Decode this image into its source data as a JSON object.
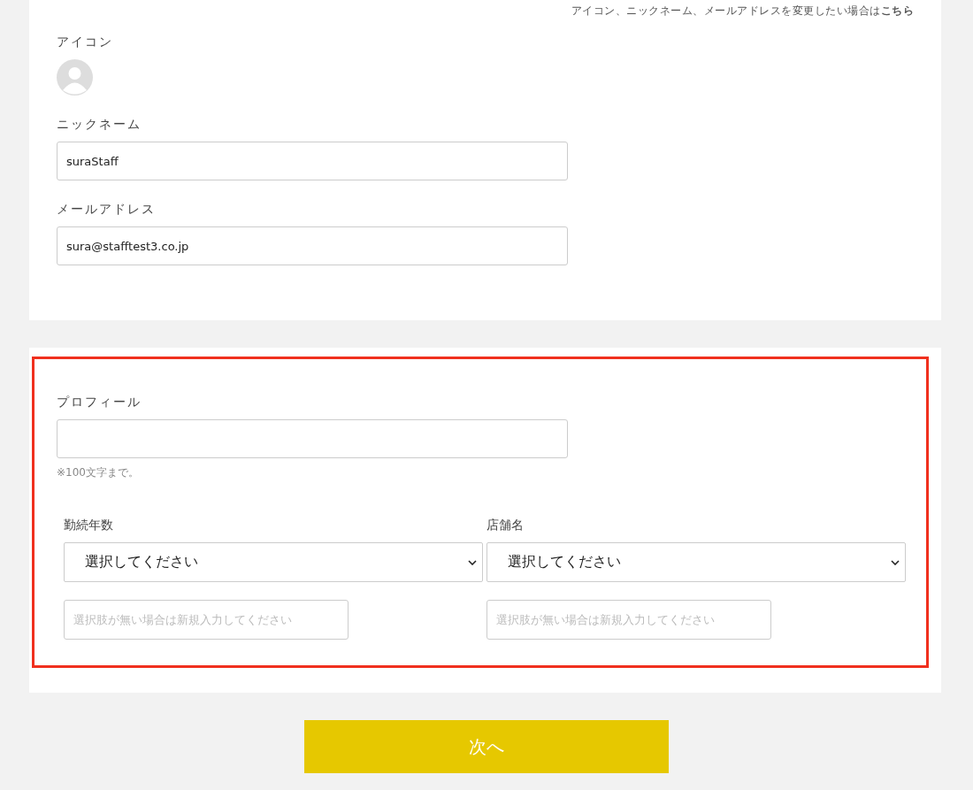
{
  "account_note": "アイコン、ニックネーム、メールアドレスを変更したい場合は**こちら**",
  "icon_label": "アイコン",
  "fields": [
    {
      "label": "ニックネーム",
      "value": "suraStaff"
    },
    {
      "label": "メールアドレス",
      "value": "sura@stafftest3.co.jp"
    }
  ],
  "profile": {
    "label": "プロフィール",
    "note": "※100文字まで。"
  },
  "selects": [
    {
      "label": "勤続年数",
      "value": "選択してください",
      "placeholder": "選択肢が無い場合は新規入力してください"
    },
    {
      "label": "店舗名",
      "value": "選択してください",
      "placeholder": "選択肢が無い場合は新規入力してください"
    }
  ],
  "next_button": "次へ"
}
